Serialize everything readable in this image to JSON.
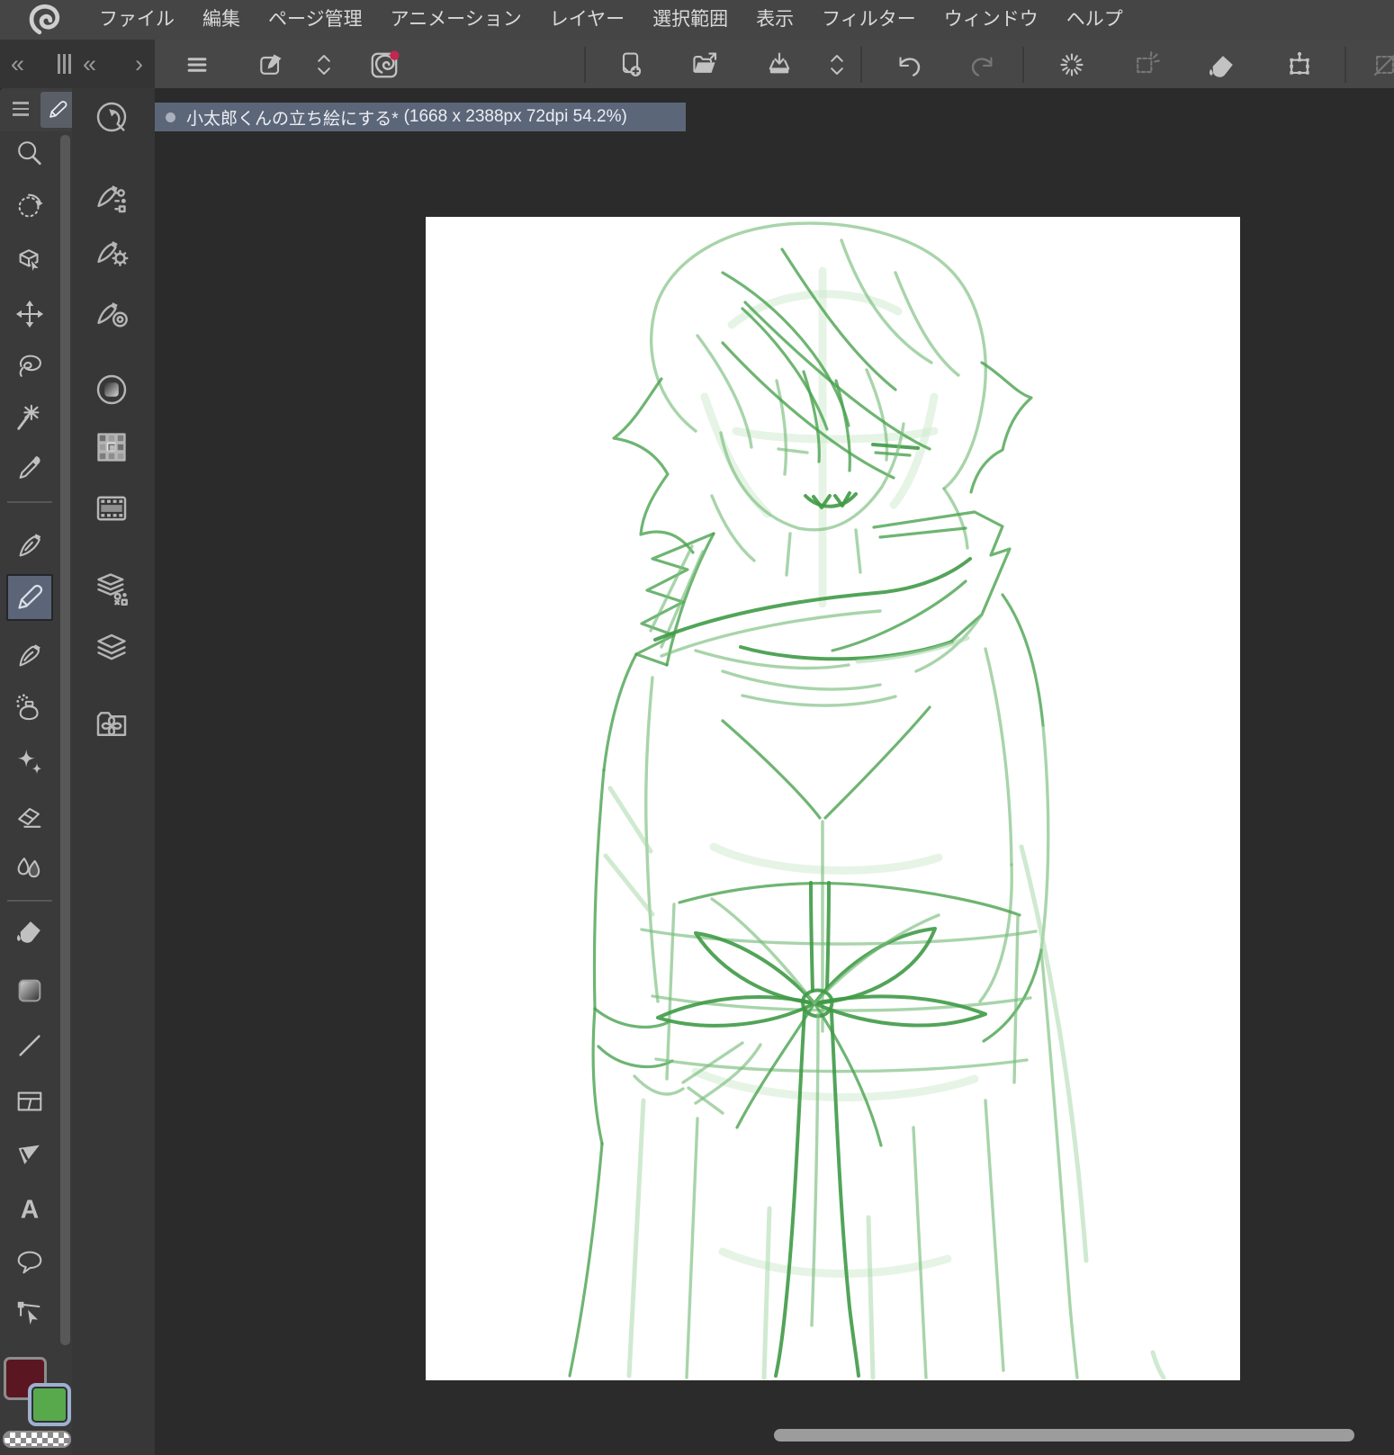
{
  "menu_bar": {
    "logo": "clip-studio-paint-logo",
    "items": [
      "ファイル",
      "編集",
      "ページ管理",
      "アニメーション",
      "レイヤー",
      "選択範囲",
      "表示",
      "フィルター",
      "ウィンドウ",
      "ヘルプ"
    ]
  },
  "panel_controls": {
    "collapse_all": "«",
    "collapse": "«",
    "expand": "›"
  },
  "tool_property_header": {
    "current_tool": "pencil"
  },
  "document_tab": {
    "title": "小太郎くんの立ち絵にする*",
    "info": "(1668 x 2388px 72dpi 54.2%)",
    "modified": true,
    "tab_color": "#5c6679"
  },
  "command_bar": {
    "icons": [
      "main-menu",
      "edit-in-clip-studio",
      "collapse-section",
      "clip-studio-news",
      "new-canvas",
      "open-file",
      "save",
      "collapse-section",
      "undo",
      "redo",
      "reselect",
      "deselect",
      "fill",
      "scale-rotate",
      "clear-selection",
      "convert-selection",
      "selection-options"
    ],
    "notification_badge_color": "#c2284e",
    "disabled_icons": [
      "redo",
      "deselect",
      "clear-selection",
      "convert-selection",
      "selection-options"
    ]
  },
  "tools": {
    "selected": "pencil",
    "items": [
      "zoom",
      "rotate-view",
      "operation",
      "move-layer",
      "lasso",
      "auto-select",
      "eyedropper",
      "pen",
      "pencil",
      "brush",
      "airbrush",
      "decoration",
      "eraser",
      "blend",
      "fill",
      "gradient",
      "figure",
      "frame-border",
      "flag",
      "text",
      "balloon",
      "correct-line"
    ]
  },
  "launcher": {
    "items": [
      "quick-access",
      "auto-action",
      "pen-settings",
      "pen-pressure",
      "tone",
      "material-grid",
      "animation-cels",
      "layer-property",
      "layers",
      "materials-folder"
    ]
  },
  "color_swatches": {
    "main_color": "#5a1722",
    "sub_color": "#58a94b",
    "selected": "sub_color"
  },
  "canvas": {
    "size": "1668 x 2388px",
    "dpi": "72dpi",
    "zoom": "54.2%",
    "sketch_color": "#4aa34f",
    "description": "rough green pencil sketch of a boy with messy hair and a high-collar coat holding a ribbon-tied gift"
  },
  "icons": {
    "text_tool_glyph": "A"
  }
}
